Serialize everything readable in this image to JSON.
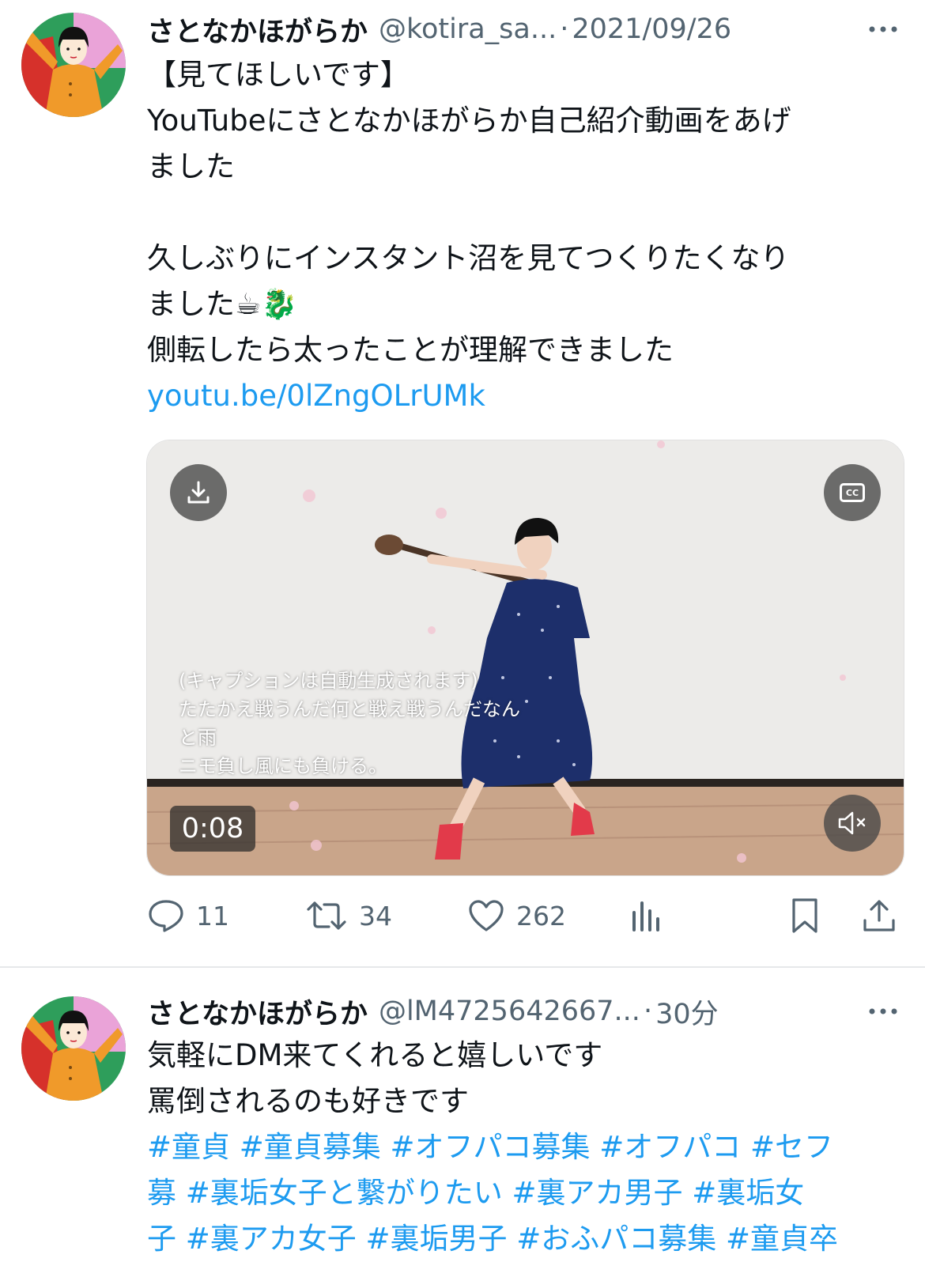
{
  "tweet1": {
    "author_name": "さとなかほがらか",
    "handle": "@kotira_sa...",
    "separator": "·",
    "time": "2021/09/26",
    "lines": [
      "【見てほしいです】",
      "YouTubeにさとなかほがらか自己紹介動画をあげ",
      "ました",
      "",
      "久しぶりにインスタント沼を見てつくりたくなり",
      "ました☕🐉",
      "側転したら太ったことが理解できました"
    ],
    "link": "youtu.be/0lZngOLrUMk",
    "video": {
      "captions": [
        "(キャプションは自動生成されます)",
        "たたかえ戦うんだ何と戦え戦うんだなん",
        "と雨",
        "ニモ負し風にも負ける。"
      ],
      "timer": "0:08",
      "download_icon": "download-icon",
      "cc_label": "CC",
      "mute_icon": "volume-muted-icon"
    },
    "stats": {
      "replies": "11",
      "retweets": "34",
      "likes": "262"
    }
  },
  "tweet2": {
    "author_name": "さとなかほがらか",
    "handle": "@lM4725642667...",
    "separator": "·",
    "time": "30分",
    "lines": [
      "気軽にDM来てくれると嬉しいです",
      "罵倒されるのも好きです"
    ],
    "hashtag_lines": [
      "#童貞 #童貞募集 #オフパコ募集 #オフパコ #セフ",
      "募 #裏垢女子と繋がりたい #裏アカ男子 #裏垢女",
      "子 #裏アカ女子 #裏垢男子 #おふパコ募集 #童貞卒"
    ]
  },
  "colors": {
    "link": "#1d9bf0",
    "secondary_text": "#536471"
  }
}
